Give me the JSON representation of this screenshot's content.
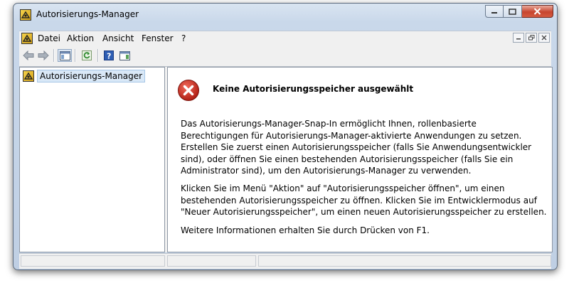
{
  "window": {
    "title": "Autorisierungs-Manager",
    "app_icon": "authorization-manager-icon"
  },
  "menu": {
    "items": [
      "Datei",
      "Aktion",
      "Ansicht",
      "Fenster",
      "?"
    ]
  },
  "toolbar": {
    "buttons": [
      "back-arrow-icon",
      "forward-arrow-icon",
      "show-hide-console-tree-icon",
      "refresh-icon",
      "help-icon",
      "show-hide-action-pane-icon"
    ]
  },
  "tree": {
    "root_label": "Autorisierungs-Manager"
  },
  "content": {
    "heading": "Keine Autorisierungsspeicher ausgewählt",
    "paragraph1": "Das Autorisierungs-Manager-Snap-In ermöglicht Ihnen, rollenbasierte Berechtigungen für Autorisierungs-Manager-aktivierte Anwendungen zu setzen. Erstellen Sie zuerst einen Autorisierungsspeicher (falls Sie Anwendungsentwickler sind), oder öffnen Sie einen bestehenden Autorisierungsspeicher (falls Sie ein Administrator sind), um den Autorisierungs-Manager zu verwenden.",
    "paragraph2": "Klicken Sie im Menü \"Aktion\" auf \"Autorisierungsspeicher öffnen\", um einen bestehenden Autorisierungsspeicher zu öffnen. Klicken Sie im Entwicklermodus auf \"Neuer Autorisierungsspeicher\", um einen neuen Autorisierungsspeicher zu erstellen.",
    "paragraph3": "Weitere Informationen erhalten Sie durch Drücken von F1.",
    "status_icon": "error-icon"
  },
  "colors": {
    "error_red": "#c8281e",
    "selection": "#d9e8f7"
  }
}
